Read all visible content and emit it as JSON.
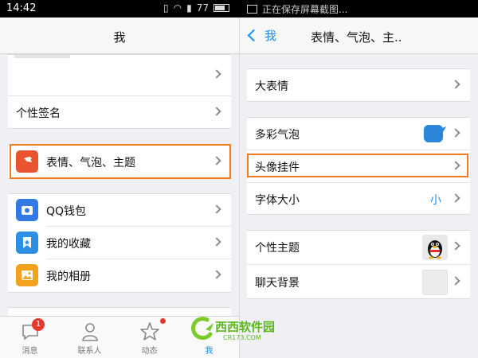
{
  "status_bar": {
    "time": "14:42",
    "battery": "77",
    "saving_text": "正在保存屏幕截图..."
  },
  "left": {
    "title": "我",
    "signature": "个性签名",
    "emoticons_bubbles_themes": "表情、气泡、主题",
    "wallet": "QQ钱包",
    "favorites": "我的收藏",
    "album": "我的相册"
  },
  "right": {
    "back": "我",
    "title": "表情、气泡、主..",
    "big_emoticons": "大表情",
    "colorful_bubbles": "多彩气泡",
    "avatar_pendant": "头像挂件",
    "font_size": "字体大小",
    "font_size_value": "小",
    "personal_theme": "个性主题",
    "chat_background": "聊天背景"
  },
  "tabs": [
    {
      "label": "消息",
      "icon": "chat-bubble-icon",
      "badge": "1"
    },
    {
      "label": "联系人",
      "icon": "person-icon"
    },
    {
      "label": "动态",
      "icon": "star-icon"
    },
    {
      "label": "我",
      "icon": "me-icon",
      "active": true
    }
  ],
  "watermark": {
    "brand": "西西软件园",
    "domain": "CR173.COM"
  },
  "colors": {
    "accent": "#1a8bf0",
    "highlight": "#f07a1e",
    "badge": "#e8382c",
    "bubble": "#2d86d9"
  }
}
